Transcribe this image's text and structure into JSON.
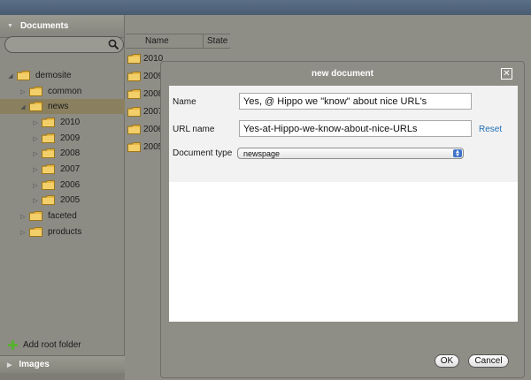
{
  "left_panel": {
    "documents_header": "Documents",
    "search": {
      "value": "",
      "placeholder": ""
    },
    "tree": [
      {
        "label": "demosite",
        "level": 0,
        "expanded": true
      },
      {
        "label": "common",
        "level": 1,
        "expanded": false
      },
      {
        "label": "news",
        "level": 1,
        "expanded": true,
        "selected": true
      },
      {
        "label": "2010",
        "level": 2,
        "expanded": false
      },
      {
        "label": "2009",
        "level": 2,
        "expanded": false
      },
      {
        "label": "2008",
        "level": 2,
        "expanded": false
      },
      {
        "label": "2007",
        "level": 2,
        "expanded": false
      },
      {
        "label": "2006",
        "level": 2,
        "expanded": false
      },
      {
        "label": "2005",
        "level": 2,
        "expanded": false
      },
      {
        "label": "faceted",
        "level": 1,
        "expanded": false
      },
      {
        "label": "products",
        "level": 1,
        "expanded": false
      }
    ],
    "add_root_folder": "Add root folder",
    "images_header": "Images"
  },
  "list_panel": {
    "columns": {
      "name": "Name",
      "state": "State"
    },
    "rows": [
      "2010",
      "2009",
      "2008",
      "2007",
      "2006",
      "2005"
    ]
  },
  "dialog": {
    "title": "new document",
    "close_glyph": "✕",
    "name_label": "Name",
    "name_value": "Yes, @ Hippo we \"know\" about nice URL's",
    "url_label": "URL name",
    "url_value": "Yes-at-Hippo-we-know-about-nice-URLs",
    "reset_label": "Reset",
    "doctype_label": "Document type",
    "doctype_value": "newspage",
    "ok_label": "OK",
    "cancel_label": "Cancel"
  },
  "colors": {
    "folder": "#e8b948",
    "link": "#1e6eb5",
    "add_icon": "#58b030",
    "select_arrows": "#3f74c9"
  },
  "icons": {
    "search": "search-icon",
    "folder": "folder-icon",
    "expand": "triangle-right-icon",
    "collapse": "triangle-down-icon",
    "add": "plus-icon",
    "close": "close-icon"
  }
}
